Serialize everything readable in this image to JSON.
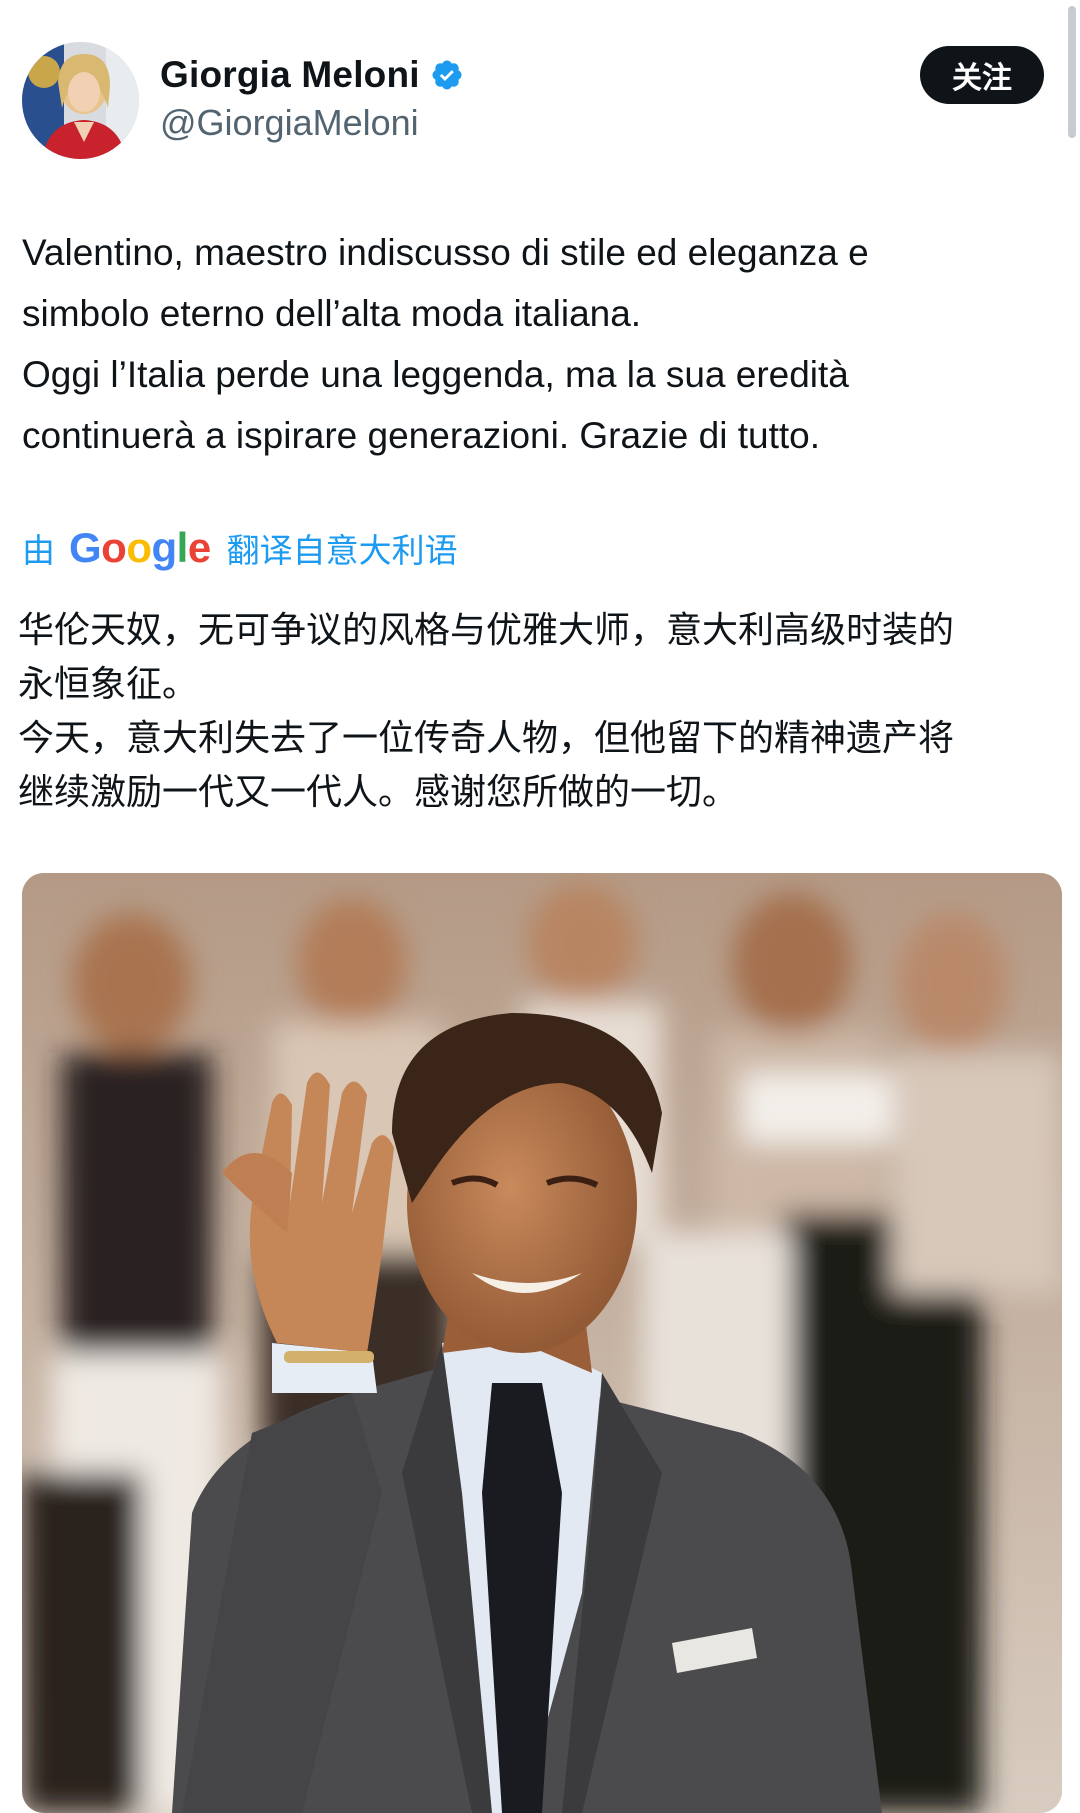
{
  "author": {
    "display_name": "Giorgia Meloni",
    "handle": "@GiorgiaMeloni",
    "verified": true,
    "avatar_icon": "profile-photo"
  },
  "follow_button": {
    "label": "关注"
  },
  "tweet": {
    "original_lines": [
      "Valentino, maestro indiscusso di stile ed eleganza e",
      "simbolo eterno dell’alta moda italiana.",
      "Oggi l’Italia perde una leggenda, ma la sua eredità",
      "continuerà a ispirare generazioni. Grazie di tutto."
    ],
    "translation": {
      "prefix": "由",
      "provider": "Google",
      "suffix": "翻译自意大利语"
    },
    "translated_lines": [
      "华伦天奴，无可争议的风格与优雅大师，意大利高级时装的",
      "永恒象征。",
      "今天，意大利失去了一位传奇人物，但他留下的精神遗产将",
      "继续激励一代又一代人。感谢您所做的一切。"
    ]
  },
  "media": {
    "type": "photo"
  },
  "colors": {
    "text_primary": "#0f1419",
    "text_secondary": "#536471",
    "link_blue": "#1d9bf0",
    "verified_blue": "#1d9bf0",
    "button_bg": "#0f1419"
  }
}
